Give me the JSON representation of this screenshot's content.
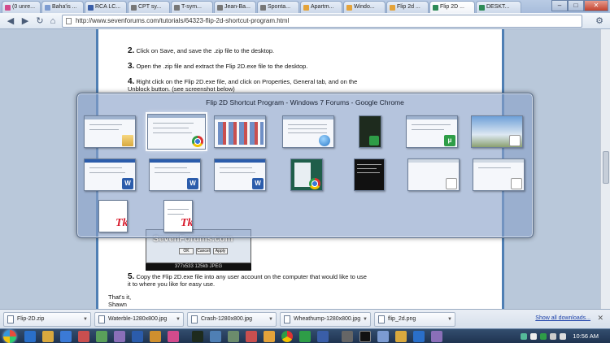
{
  "browser": {
    "tabs": [
      {
        "label": "(0 unre...",
        "color": "#d24b8c",
        "active": false
      },
      {
        "label": "Baha'is ...",
        "color": "#7c9bd1",
        "active": false
      },
      {
        "label": "RCA LC...",
        "color": "#3a5ea8",
        "active": false
      },
      {
        "label": "CPT sy...",
        "color": "#777777",
        "active": false
      },
      {
        "label": "T-sym...",
        "color": "#777777",
        "active": false
      },
      {
        "label": "Jean-Ba...",
        "color": "#777777",
        "active": false
      },
      {
        "label": "Sponta...",
        "color": "#777777",
        "active": false
      },
      {
        "label": "Apartm...",
        "color": "#e4a33a",
        "active": false
      },
      {
        "label": "Windo...",
        "color": "#e4a33a",
        "active": false
      },
      {
        "label": "Flip 2d ...",
        "color": "#e4a33a",
        "active": false
      },
      {
        "label": "Flip 2D ...",
        "color": "#2e8b57",
        "active": true
      },
      {
        "label": "DESKT...",
        "color": "#2e8b57",
        "active": false
      }
    ],
    "url": "http://www.sevenforums.com/tutorials/64323-flip-2d-shortcut-program.html",
    "win_minimize": "–",
    "win_maximize": "□",
    "win_close": "✕"
  },
  "article": {
    "step2_num": "2.",
    "step2": "Click on Save, and save the .zip file to the desktop.",
    "step3_num": "3.",
    "step3": "Open the .zip file and extract the Flip 2D.exe file to the desktop.",
    "step4_num": "4.",
    "step4": "Right click on the Flip 2D.exe file, and click on Properties, General tab, and on the",
    "step4b": "Unblock button. (see screenshot below)",
    "step5_num": "5.",
    "step5": "Copy the Flip 2D.exe file into any user account on the computer that would like to use",
    "step5b": "it to where you like for easy use.",
    "closing1": "That's it,",
    "closing2": "Shawn",
    "shot_logo": "SevenForums.com",
    "shot_ok": "OK",
    "shot_cancel": "Cancel",
    "shot_apply": "Apply",
    "shot_caption": "377x533  125kb  JPEG"
  },
  "flip2d": {
    "title": "Flip 2D Shortcut Program - Windows 7 Forums - Google Chrome"
  },
  "downloads": {
    "items": [
      {
        "name": "Flip-2D.zip"
      },
      {
        "name": "Waterble-1280x800.jpg"
      },
      {
        "name": "Crash-1280x800.jpg"
      },
      {
        "name": "Wheathump-1280x800.jpg"
      },
      {
        "name": "flip_2d.png"
      }
    ],
    "show_all": "Show all downloads...",
    "close": "✕"
  },
  "taskbar": {
    "clock": "10:56 AM"
  }
}
